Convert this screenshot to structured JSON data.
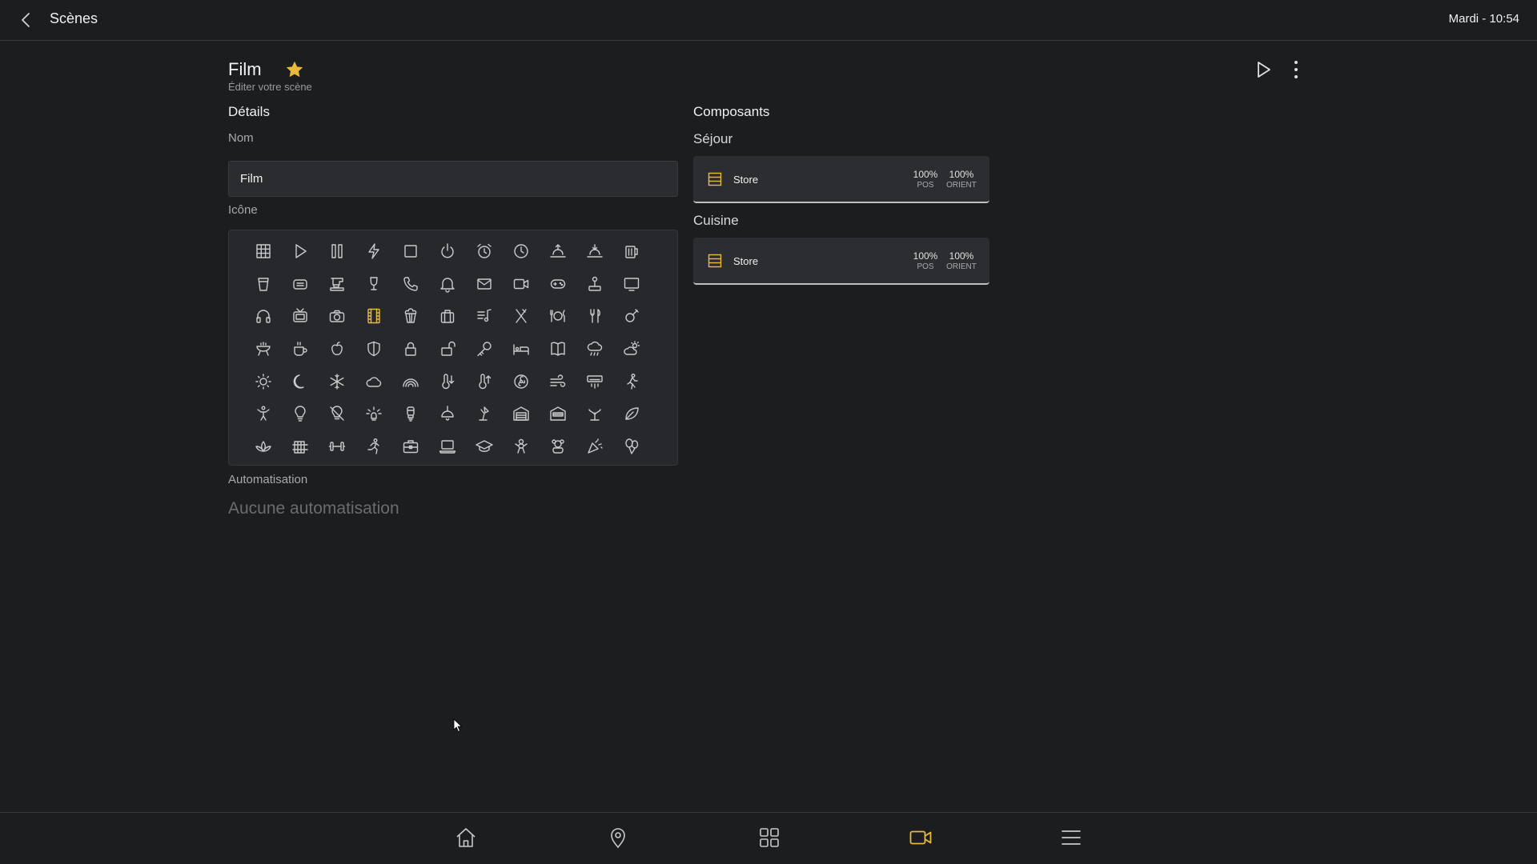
{
  "topbar": {
    "title": "Scènes",
    "clock": "Mardi - 10:54"
  },
  "scene": {
    "title": "Film",
    "subtitle": "Éditer votre scène",
    "favorite": true
  },
  "details": {
    "section_title": "Détails",
    "name_label": "Nom",
    "name_value": "Film",
    "icon_label": "Icône",
    "automation_label": "Automatisation",
    "automation_empty": "Aucune automatisation"
  },
  "components": {
    "section_title": "Composants",
    "rooms": [
      {
        "name": "Séjour",
        "device": {
          "name": "Store",
          "pos_value": "100%",
          "pos_label": "POS",
          "orient_value": "100%",
          "orient_label": "ORIENT"
        }
      },
      {
        "name": "Cuisine",
        "device": {
          "name": "Store",
          "pos_value": "100%",
          "pos_label": "POS",
          "orient_value": "100%",
          "orient_label": "ORIENT"
        }
      }
    ]
  },
  "icon_choices": [
    "grid-icon",
    "play-icon",
    "pause-icon",
    "lightning-icon",
    "stop-icon",
    "power-icon",
    "alarm-clock-icon",
    "clock-icon",
    "sunrise-icon",
    "sunset-icon",
    "beer-icon",
    "glass-icon",
    "toaster-icon",
    "coffee-machine-icon",
    "wine-glass-icon",
    "phone-icon",
    "bell-icon",
    "mail-icon",
    "video-camera-icon",
    "gamepad-icon",
    "joystick-icon",
    "monitor-icon",
    "headphones-icon",
    "tv-icon",
    "camera-icon",
    "film-icon",
    "popcorn-icon",
    "suitcase-icon",
    "music-icon",
    "utensils-icon",
    "dining-icon",
    "fork-knife-icon",
    "guitar-icon",
    "bbq-icon",
    "coffee-cup-icon",
    "apple-icon",
    "shield-icon",
    "lock-icon",
    "unlock-icon",
    "key-icon",
    "bed-icon",
    "book-icon",
    "rain-icon",
    "cloud-sun-icon",
    "sun-icon",
    "moon-icon",
    "snowflake-icon",
    "cloud-icon",
    "rainbow-icon",
    "temperature-down-icon",
    "temperature-up-icon",
    "fan-icon",
    "wind-icon",
    "air-conditioner-icon",
    "person-walking-icon",
    "person-arms-icon",
    "lightbulb-icon",
    "lightbulb-off-icon",
    "light-rays-icon",
    "led-bulb-icon",
    "ceiling-lamp-icon",
    "desk-lamp-icon",
    "garage-icon",
    "garage-open-icon",
    "plant-sprout-icon",
    "leaf-icon",
    "lotus-icon",
    "radiator-icon",
    "dumbbell-icon",
    "running-icon",
    "briefcase-icon",
    "laptop-icon",
    "graduation-cap-icon",
    "baby-icon",
    "teddy-bear-icon",
    "party-icon",
    "balloons-icon"
  ],
  "selected_icon": "film-icon",
  "bottom_nav": [
    "home-icon",
    "location-pin-icon",
    "dashboard-grid-icon",
    "scenes-camera-icon",
    "menu-icon"
  ],
  "bottom_nav_active": "scenes-camera-icon",
  "colors": {
    "background": "#1c1d1f",
    "accent": "#e8b93a",
    "panel": "#27282b",
    "card": "#2c2d30"
  }
}
